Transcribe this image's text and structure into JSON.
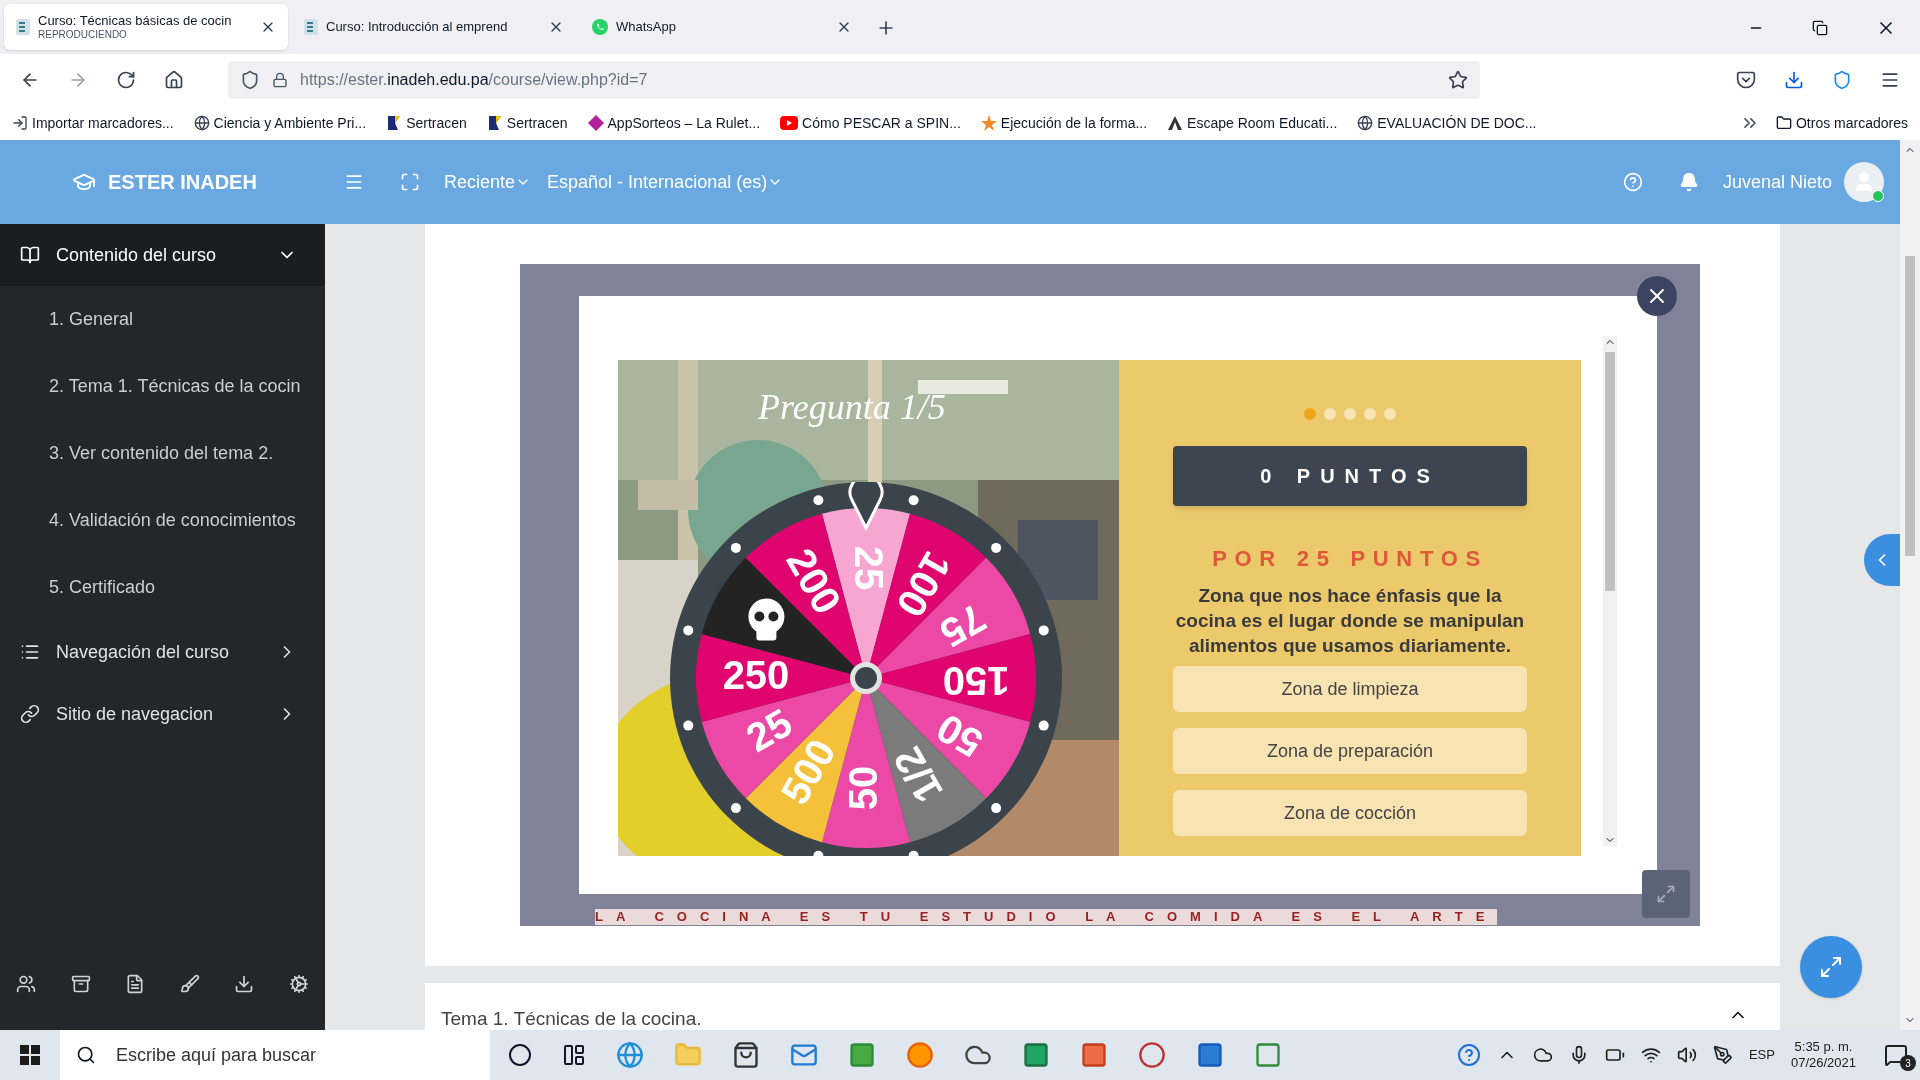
{
  "browser": {
    "tabs": [
      {
        "title": "Curso: Técnicas básicas de cocin",
        "subtitle": "REPRODUCIENDO",
        "selected": true,
        "kind": "course"
      },
      {
        "title": "Curso: Introducción al emprend",
        "selected": false,
        "kind": "course"
      },
      {
        "title": "WhatsApp",
        "selected": false,
        "kind": "whatsapp"
      }
    ],
    "url": {
      "prefix": "https://ester.",
      "host": "inadeh.edu.pa",
      "path": "/course/view.php?id=7"
    },
    "bookmarks": [
      {
        "label": "Importar marcadores...",
        "kind": "import"
      },
      {
        "label": "Ciencia y Ambiente Pri...",
        "kind": "globe"
      },
      {
        "label": "Sertracen",
        "kind": "flag"
      },
      {
        "label": "Sertracen",
        "kind": "flag"
      },
      {
        "label": "AppSorteos – La Rulet...",
        "kind": "diamond"
      },
      {
        "label": "Cómo PESCAR a SPIN...",
        "kind": "video"
      },
      {
        "label": "Ejecución de la forma...",
        "kind": "star"
      },
      {
        "label": "Escape Room Educati...",
        "kind": "triangle"
      },
      {
        "label": "EVALUACIÓN DE DOC...",
        "kind": "globe"
      }
    ],
    "other_bookmarks": "Otros marcadores"
  },
  "header": {
    "brand": "ESTER INADEH",
    "menus": [
      "Reciente",
      "Español - Internacional (es)"
    ],
    "user": "Juvenal Nieto",
    "online": true
  },
  "sidebar": {
    "sections": [
      {
        "label": "Contenido del curso",
        "kind": "book",
        "expanded": true,
        "children": [
          "1. General",
          "2. Tema 1. Técnicas de la cocin",
          "3. Ver contenido del tema 2.",
          "4. Validación de conocimientos",
          "5. Certificado"
        ]
      },
      {
        "label": "Navegación del curso",
        "kind": "list",
        "expanded": false
      },
      {
        "label": "Sitio de navegacion",
        "kind": "link",
        "expanded": false
      }
    ]
  },
  "quiz": {
    "title": "Pregunta 1/5",
    "wheel": [
      {
        "label": "25",
        "color": "#f7a6d2",
        "kind": "number"
      },
      {
        "label": "100",
        "color": "#e0046f",
        "kind": "number"
      },
      {
        "label": "75",
        "color": "#ec48a6",
        "kind": "number"
      },
      {
        "label": "150",
        "color": "#e0046f",
        "kind": "number"
      },
      {
        "label": "50",
        "color": "#ec48a6",
        "kind": "number"
      },
      {
        "label": "1/2",
        "color": "#7b7b7b",
        "kind": "number"
      },
      {
        "label": "50",
        "color": "#ec48a6",
        "kind": "number"
      },
      {
        "label": "500",
        "color": "#f5c13a",
        "kind": "number"
      },
      {
        "label": "25",
        "color": "#ec48a6",
        "kind": "number"
      },
      {
        "label": "250",
        "color": "#e0046f",
        "kind": "number"
      },
      {
        "color": "#232323",
        "kind": "skull"
      },
      {
        "label": "200",
        "color": "#e0046f",
        "kind": "number"
      }
    ],
    "steps": [
      {
        "selected": true
      },
      {
        "selected": false
      },
      {
        "selected": false
      },
      {
        "selected": false
      },
      {
        "selected": false
      }
    ],
    "score": "0 PUNTOS",
    "prize": "POR 25 PUNTOS",
    "question": "Zona que nos hace énfasis que la cocina es el lugar donde se manipulan alimentos que usamos diariamente.",
    "options": [
      "Zona de limpieza",
      "Zona de preparación",
      "Zona de cocción"
    ]
  },
  "banner": "LA COCINA ES TU ESTUDIO LA COMIDA ES EL ARTE",
  "next_section": "Tema 1. Técnicas de la cocina.",
  "taskbar": {
    "search": {
      "placeholder": "Escribe aquí para buscar"
    },
    "language": "ESP",
    "time": "5:35 p. m.",
    "date": "07/26/2021",
    "notifications": "3"
  }
}
